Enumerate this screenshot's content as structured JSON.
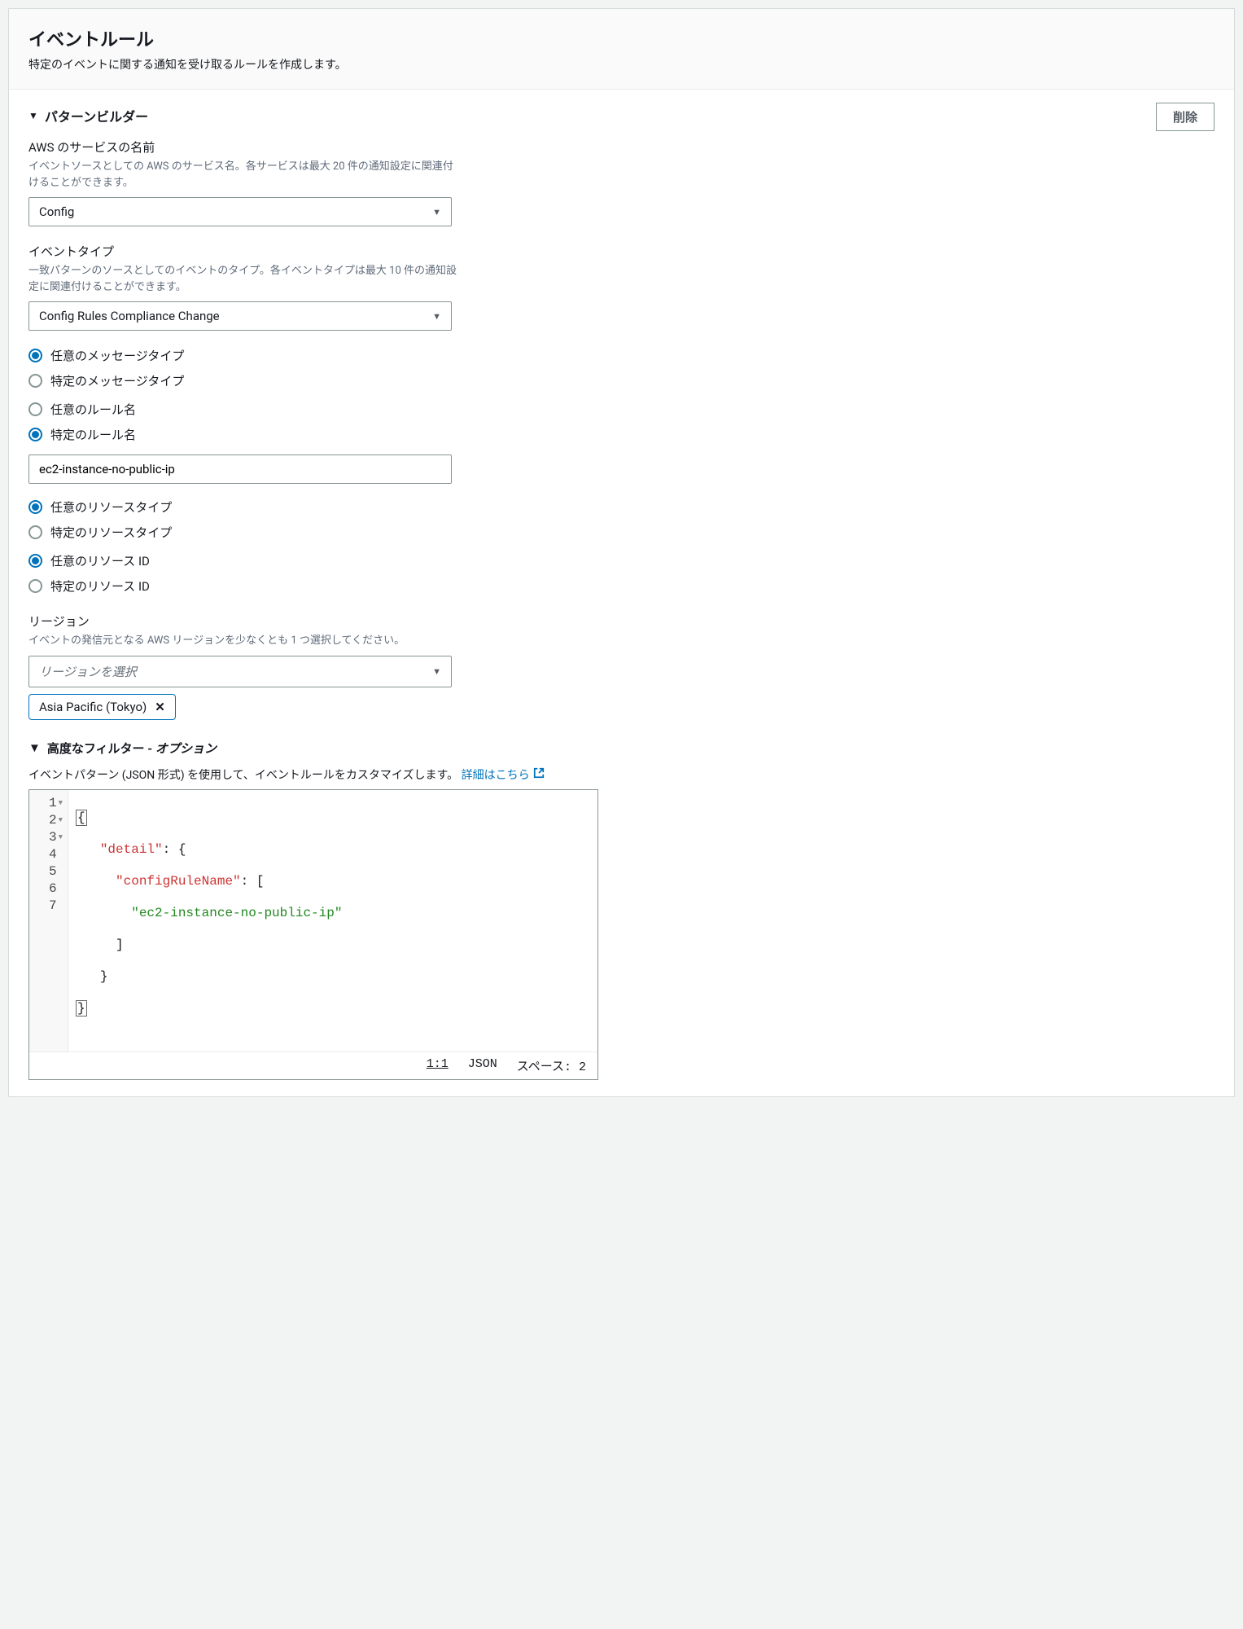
{
  "header": {
    "title": "イベントルール",
    "subtitle": "特定のイベントに関する通知を受け取るルールを作成します。"
  },
  "delete_label": "削除",
  "pattern_builder_label": "パターンビルダー",
  "service": {
    "label": "AWS のサービスの名前",
    "desc": "イベントソースとしての AWS のサービス名。各サービスは最大 20 件の通知設定に関連付けることができます。",
    "value": "Config"
  },
  "event_type": {
    "label": "イベントタイプ",
    "desc": "一致パターンのソースとしてのイベントのタイプ。各イベントタイプは最大 10 件の通知設定に関連付けることができます。",
    "value": "Config Rules Compliance Change"
  },
  "radios1": {
    "opt1": "任意のメッセージタイプ",
    "opt2": "特定のメッセージタイプ"
  },
  "radios2": {
    "opt1": "任意のルール名",
    "opt2": "特定のルール名"
  },
  "rule_input_value": "ec2-instance-no-public-ip",
  "radios3": {
    "opt1": "任意のリソースタイプ",
    "opt2": "特定のリソースタイプ"
  },
  "radios4": {
    "opt1": "任意のリソース ID",
    "opt2": "特定のリソース ID"
  },
  "region": {
    "label": "リージョン",
    "desc": "イベントの発信元となる AWS リージョンを少なくとも 1 つ選択してください。",
    "placeholder": "リージョンを選択",
    "selected_tag": "Asia Pacific (Tokyo)"
  },
  "advanced": {
    "label_a": "高度なフィルター - ",
    "label_b": "オプション",
    "desc": "イベントパターン (JSON 形式) を使用して、イベントルールをカスタマイズします。 ",
    "learn_more": "詳細はこちら"
  },
  "json": {
    "line1_brace": "{",
    "line2_key": "\"detail\"",
    "line2_rest": ": {",
    "line3_key": "\"configRuleName\"",
    "line3_rest": ": [",
    "line4_str": "\"ec2-instance-no-public-ip\"",
    "line5": "]",
    "line6": "}",
    "line7_brace": "}",
    "ln": {
      "1": "1",
      "2": "2",
      "3": "3",
      "4": "4",
      "5": "5",
      "6": "6",
      "7": "7"
    }
  },
  "status": {
    "pos": "1:1",
    "lang": "JSON",
    "spaces": "スペース: 2"
  }
}
